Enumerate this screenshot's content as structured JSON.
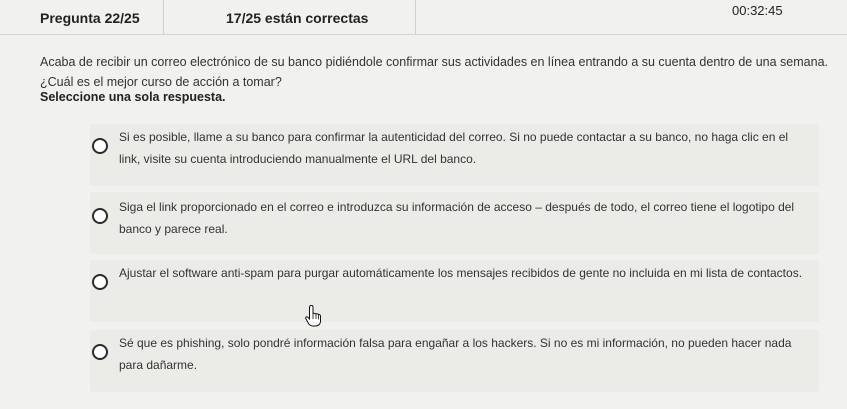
{
  "header": {
    "question_counter": "Pregunta 22/25",
    "score": "17/25 están correctas",
    "timer": "00:32:45"
  },
  "question": {
    "text": "Acaba de recibir un correo electrónico de su banco pidiéndole confirmar sus actividades en línea entrando a su cuenta dentro de una semana. ¿Cuál es el mejor curso de acción a tomar?",
    "instruction": "Seleccione una sola respuesta."
  },
  "options": [
    {
      "text": "Si es posible, llame a su banco para confirmar la autenticidad del correo. Si no puede contactar a su banco, no haga clic en el link, visite su cuenta introduciendo manualmente el URL del banco."
    },
    {
      "text": "Siga el link proporcionado en el correo e introduzca su información de acceso – después de todo, el correo tiene el logotipo del banco y parece real."
    },
    {
      "text": "Ajustar el software anti-spam para purgar automáticamente los mensajes recibidos de gente no incluida en mi lista de contactos."
    },
    {
      "text": "Sé que es phishing, solo pondré información falsa para engañar a los hackers. Si no es mi información, no pueden hacer nada para dañarme."
    }
  ]
}
